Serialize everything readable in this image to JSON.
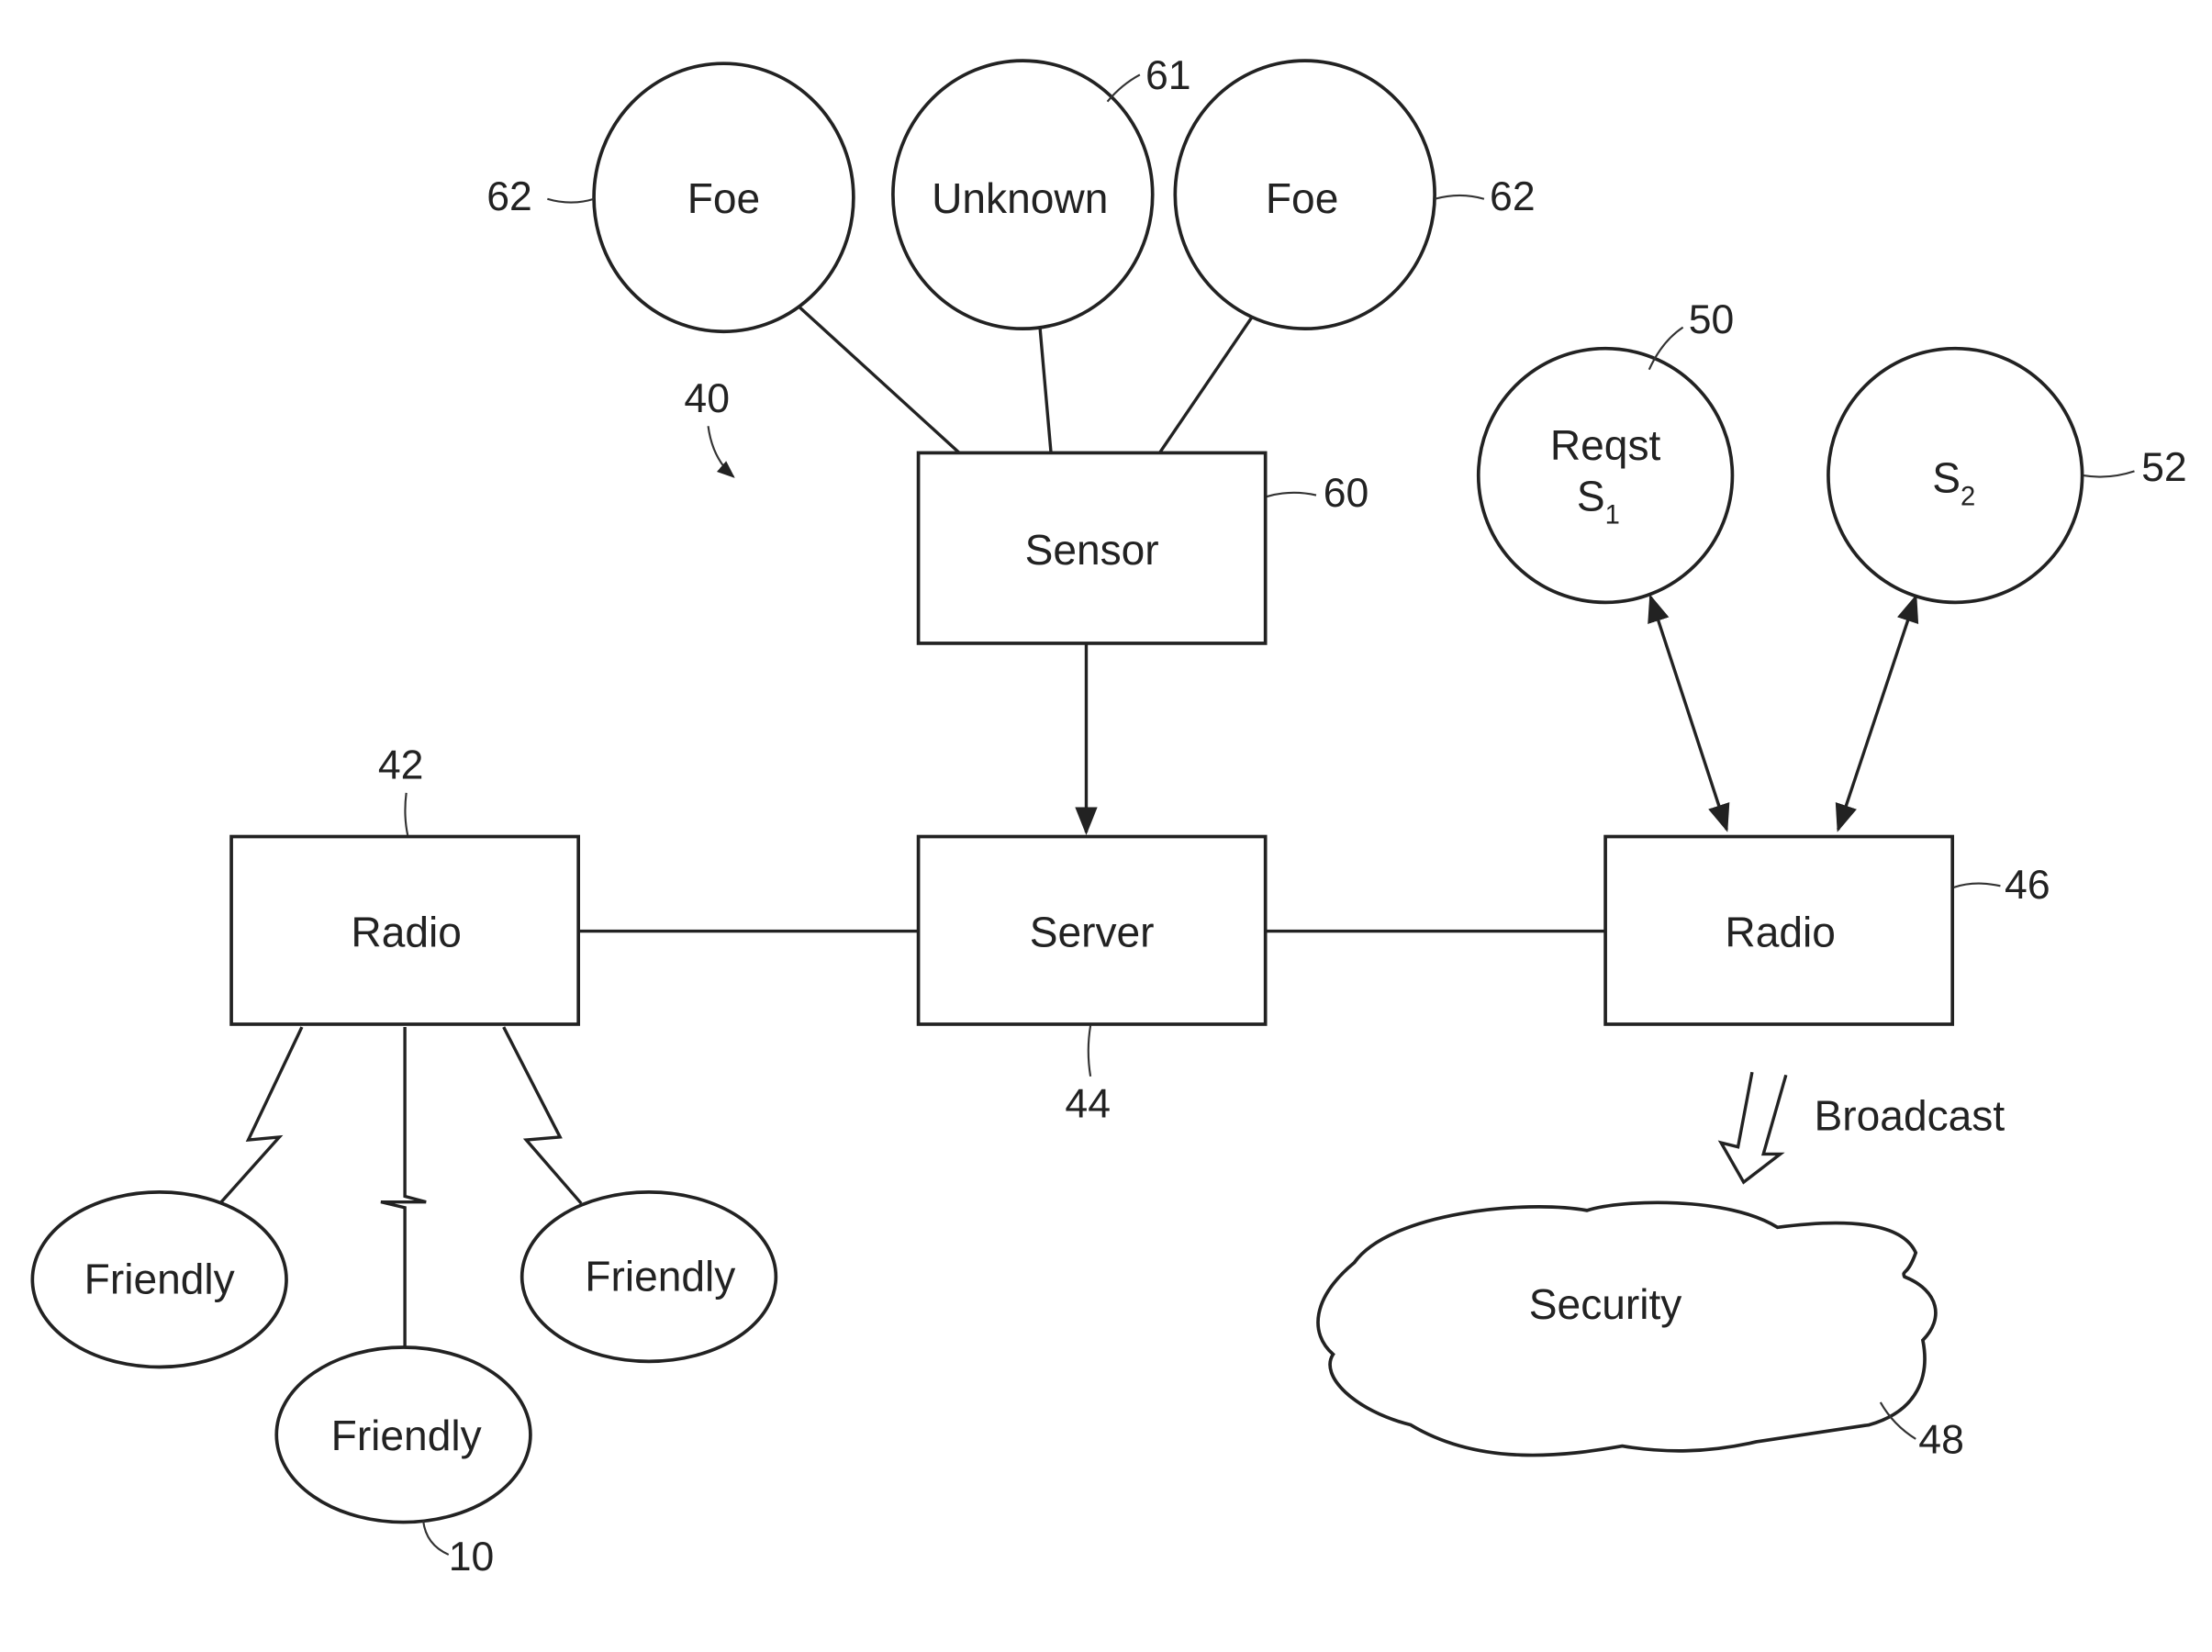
{
  "figure": {
    "system_ref": "40",
    "nodes": {
      "foe_left": {
        "label": "Foe",
        "ref": "62"
      },
      "unknown": {
        "label": "Unknown",
        "ref": "61"
      },
      "foe_right": {
        "label": "Foe",
        "ref": "62"
      },
      "sensor": {
        "label": "Sensor",
        "ref": "60"
      },
      "server": {
        "label": "Server",
        "ref": "44"
      },
      "radio_left": {
        "label": "Radio",
        "ref": "42"
      },
      "radio_right": {
        "label": "Radio",
        "ref": "46"
      },
      "request": {
        "label_line1": "Reqst",
        "label_line2": "S",
        "label_sub": "1",
        "ref": "50"
      },
      "s2": {
        "label": "S",
        "label_sub": "2",
        "ref": "52"
      },
      "friendly_left": {
        "label": "Friendly"
      },
      "friendly_bottom": {
        "label": "Friendly",
        "ref": "10"
      },
      "friendly_right": {
        "label": "Friendly"
      },
      "security": {
        "label": "Security",
        "ref": "48"
      }
    },
    "broadcast_label": "Broadcast"
  }
}
